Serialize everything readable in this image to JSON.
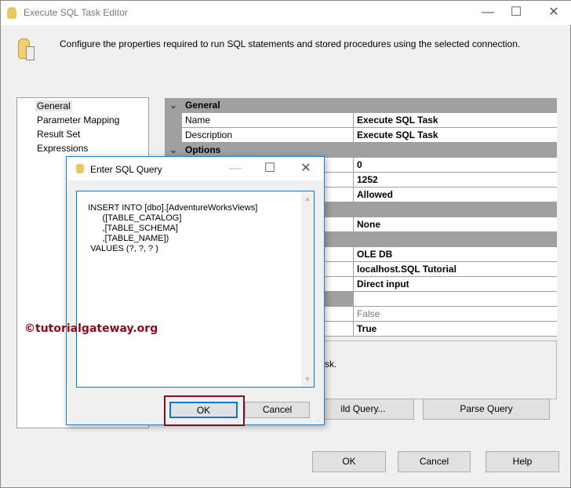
{
  "window": {
    "title": "Execute SQL Task Editor",
    "minimize": "—",
    "maximize": "☐",
    "close": "✕"
  },
  "header": {
    "description": "Configure the properties required to run SQL statements and stored procedures using the selected connection."
  },
  "nav": [
    "General",
    "Parameter Mapping",
    "Result Set",
    "Expressions"
  ],
  "grid": {
    "cat_general": "General",
    "name_label": "Name",
    "name_value": "Execute SQL Task",
    "desc_label": "Description",
    "desc_value": "Execute SQL Task",
    "cat_options": "Options",
    "values": [
      "0",
      "1252",
      "Allowed",
      "None",
      "OLE DB",
      "localhost.SQL Tutorial",
      "Direct input",
      "False",
      "True"
    ]
  },
  "description_panel": {
    "text": "sk."
  },
  "buttons": {
    "build_query": "ild Query...",
    "parse_query": "Parse Query",
    "ok": "OK",
    "cancel": "Cancel",
    "help": "Help"
  },
  "dialog": {
    "title": "Enter SQL Query",
    "query": "INSERT INTO [dbo].[AdventureWorksViews]\n          ([TABLE_CATALOG]\n          ,[TABLE_SCHEMA]\n          ,[TABLE_NAME])\n     VALUES (?, ?, ? )",
    "ok": "OK",
    "cancel": "Cancel",
    "minimize": "—",
    "maximize": "☐",
    "close": "✕"
  },
  "watermark": "©tutorialgateway.org",
  "colors": {
    "highlight": "#7b1020",
    "accent": "#0078d7"
  }
}
